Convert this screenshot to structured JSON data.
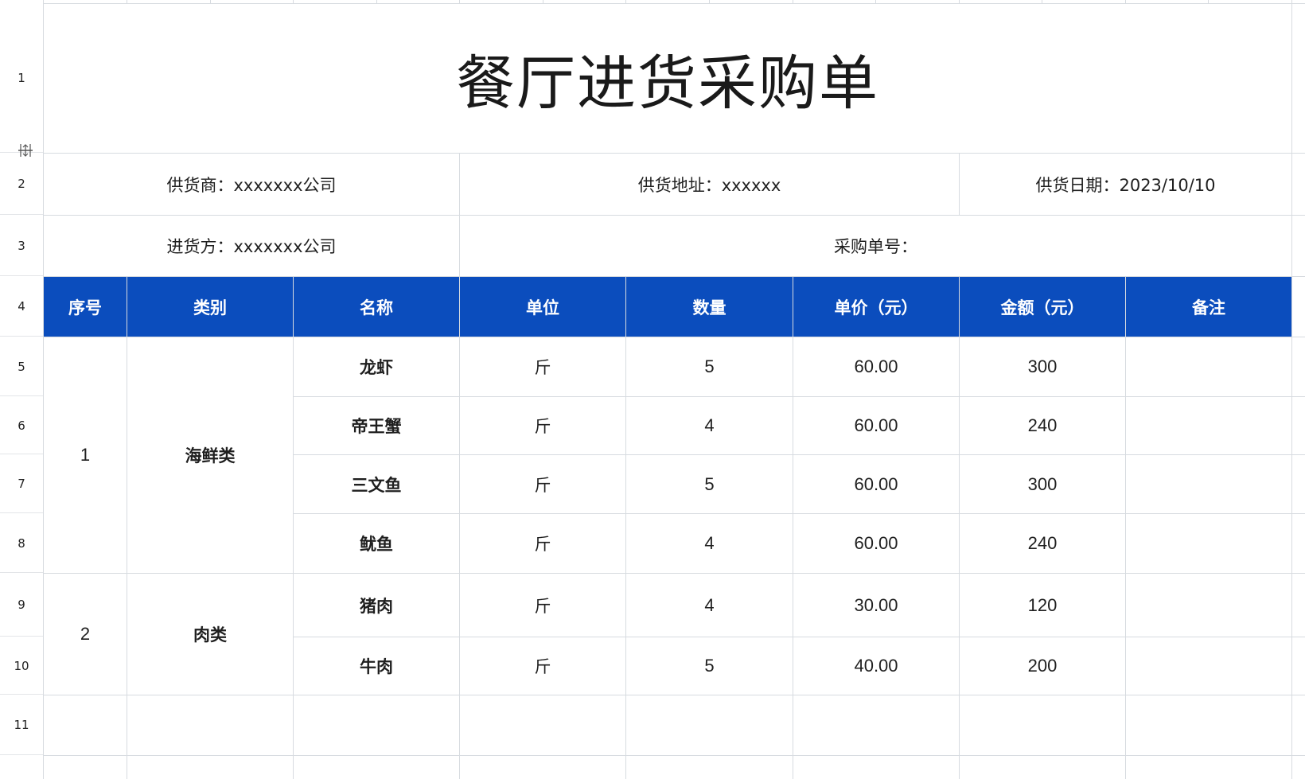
{
  "sheet": {
    "title": "餐厅进货采购单",
    "row_numbers": [
      "1",
      "2",
      "3",
      "4",
      "5",
      "6",
      "7",
      "8",
      "9",
      "10",
      "11"
    ],
    "info": {
      "supplier": "供货商：xxxxxxx公司",
      "address": "供货地址：xxxxxx",
      "date": "供货日期：2023/10/10",
      "buyer": "进货方：xxxxxxx公司",
      "order_no": "采购单号："
    },
    "headers": [
      "序号",
      "类别",
      "名称",
      "单位",
      "数量",
      "单价（元）",
      "金额（元）",
      "备注"
    ],
    "groups": [
      {
        "seq": "1",
        "category": "海鲜类"
      },
      {
        "seq": "2",
        "category": "肉类"
      }
    ],
    "rows": [
      {
        "name": "龙虾",
        "unit": "斤",
        "qty": "5",
        "price": "60.00",
        "amount": "300",
        "note": ""
      },
      {
        "name": "帝王蟹",
        "unit": "斤",
        "qty": "4",
        "price": "60.00",
        "amount": "240",
        "note": ""
      },
      {
        "name": "三文鱼",
        "unit": "斤",
        "qty": "5",
        "price": "60.00",
        "amount": "300",
        "note": ""
      },
      {
        "name": "鱿鱼",
        "unit": "斤",
        "qty": "4",
        "price": "60.00",
        "amount": "240",
        "note": ""
      },
      {
        "name": "猪肉",
        "unit": "斤",
        "qty": "4",
        "price": "30.00",
        "amount": "120",
        "note": ""
      },
      {
        "name": "牛肉",
        "unit": "斤",
        "qty": "5",
        "price": "40.00",
        "amount": "200",
        "note": ""
      }
    ],
    "colors": {
      "header_bg": "#0b4dbd",
      "header_text": "#ffffff",
      "grid": "#d7dbe0"
    },
    "icons": {
      "row_resize": "row-resize-icon"
    }
  }
}
